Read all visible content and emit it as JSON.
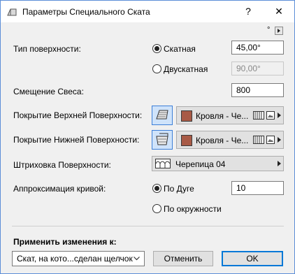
{
  "window": {
    "title": "Параметры Специального Ската",
    "help_glyph": "?",
    "close_glyph": "✕"
  },
  "settings_corner": {
    "dot": "°",
    "arrow": "▸"
  },
  "surface_type": {
    "label": "Тип поверхности:",
    "option_slope": {
      "label": "Скатная",
      "selected": true,
      "value": "45,00°"
    },
    "option_double": {
      "label": "Двускатная",
      "selected": false,
      "value": "90,00°"
    }
  },
  "eave_offset": {
    "label": "Смещение Свеса:",
    "value": "800"
  },
  "top_surface": {
    "label": "Покрытие Верхней Поверхности:",
    "material": "Кровля - Че...",
    "swatch_color": "#a85a46"
  },
  "bottom_surface": {
    "label": "Покрытие Нижней Поверхности:",
    "material": "Кровля - Че...",
    "swatch_color": "#a85a46"
  },
  "surface_hatch": {
    "label": "Штриховка Поверхности:",
    "value": "Черепица 04"
  },
  "curve_approx": {
    "label": "Аппроксимация кривой:",
    "option_arc": {
      "label": "По Дуге",
      "selected": true,
      "value": "10"
    },
    "option_circle": {
      "label": "По окружности",
      "selected": false
    }
  },
  "footer": {
    "apply_label": "Применить изменения к:",
    "apply_value": "Скат, на кото...сделан щелчок",
    "cancel_label": "Отменить",
    "ok_label": "OK"
  },
  "colors": {
    "accent": "#0078d7",
    "window_border": "#5c8ed8",
    "icon_button_bg": "#cfe3fa"
  }
}
